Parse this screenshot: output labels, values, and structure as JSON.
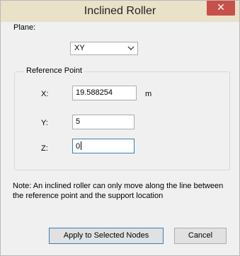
{
  "window": {
    "title": "Inclined Roller",
    "close_glyph": "✕"
  },
  "plane": {
    "label": "Plane:",
    "selected": "XY"
  },
  "reference_point": {
    "title": "Reference Point",
    "x_label": "X:",
    "x_value": "19.588254",
    "x_unit": "m",
    "y_label": "Y:",
    "y_value": "5",
    "z_label": "Z:",
    "z_value": "0"
  },
  "note_text": "Note: An inclined roller can only move along the line between the reference point and the support location",
  "buttons": {
    "apply": "Apply to Selected Nodes",
    "cancel": "Cancel"
  },
  "colors": {
    "titlebar": "#e9e1c8",
    "close_button": "#c7504a",
    "focus_border": "#3c7fb1"
  }
}
